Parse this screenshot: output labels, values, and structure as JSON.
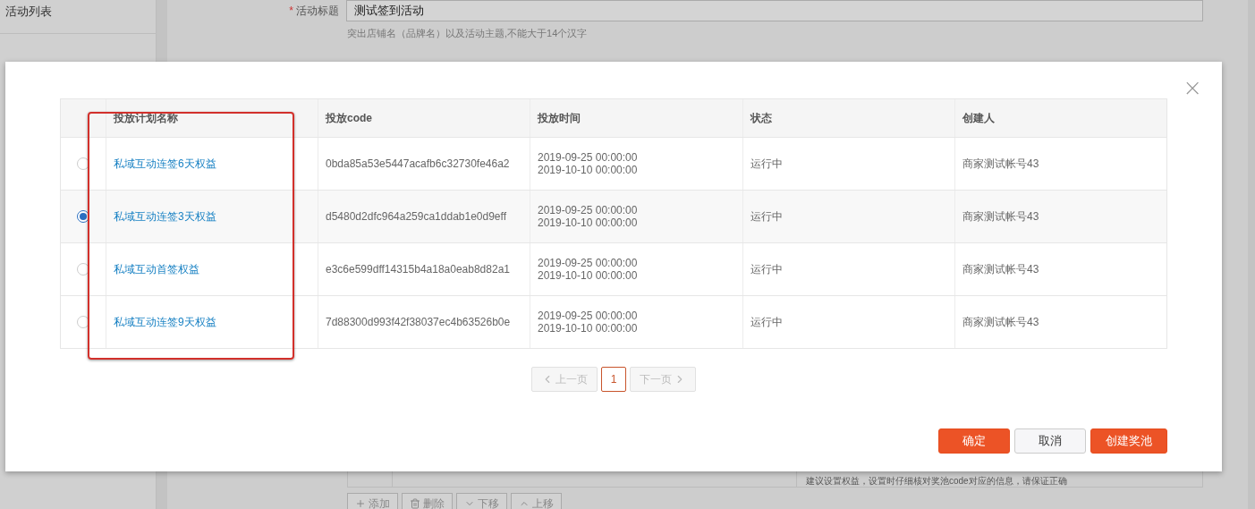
{
  "sidebar": {
    "items": [
      {
        "label": "活动列表"
      }
    ]
  },
  "form": {
    "title_field": {
      "required_mark": "*",
      "label": "活动标题",
      "value": "测试签到活动",
      "hint": "突出店铺名（品牌名）以及活动主题,不能大于14个汉字"
    },
    "rights_hint": "建议设置权益，设置时仔细核对奖池code对应的信息，请保证正确",
    "row_buttons": [
      {
        "label": "添加"
      },
      {
        "label": "删除"
      },
      {
        "label": "下移"
      },
      {
        "label": "上移"
      }
    ]
  },
  "dialog": {
    "close": "×",
    "table": {
      "columns": [
        "投放计划名称",
        "投放code",
        "投放时间",
        "状态",
        "创建人"
      ],
      "rows": [
        {
          "selected": false,
          "name": "私域互动连签6天权益",
          "code": "0bda85a53e5447acafb6c32730fe46a2",
          "start": "2019-09-25 00:00:00",
          "end": "2019-10-10 00:00:00",
          "status": "运行中",
          "creator": "商家测试帐号43"
        },
        {
          "selected": true,
          "name": "私域互动连签3天权益",
          "code": "d5480d2dfc964a259ca1ddab1e0d9eff",
          "start": "2019-09-25 00:00:00",
          "end": "2019-10-10 00:00:00",
          "status": "运行中",
          "creator": "商家测试帐号43"
        },
        {
          "selected": false,
          "name": "私域互动首签权益",
          "code": "e3c6e599dff14315b4a18a0eab8d82a1",
          "start": "2019-09-25 00:00:00",
          "end": "2019-10-10 00:00:00",
          "status": "运行中",
          "creator": "商家测试帐号43"
        },
        {
          "selected": false,
          "name": "私域互动连签9天权益",
          "code": "7d88300d993f42f38037ec4b63526b0e",
          "start": "2019-09-25 00:00:00",
          "end": "2019-10-10 00:00:00",
          "status": "运行中",
          "creator": "商家测试帐号43"
        }
      ]
    },
    "pagination": {
      "prev": "上一页",
      "pages": [
        {
          "label": "1",
          "selected": true
        }
      ],
      "next": "下一页"
    },
    "buttons": [
      {
        "label": "确定",
        "kind": "primary"
      },
      {
        "label": "取消",
        "kind": "normal"
      },
      {
        "label": "创建奖池",
        "kind": "primary"
      }
    ]
  },
  "annotation": {
    "kind": "highlight"
  }
}
